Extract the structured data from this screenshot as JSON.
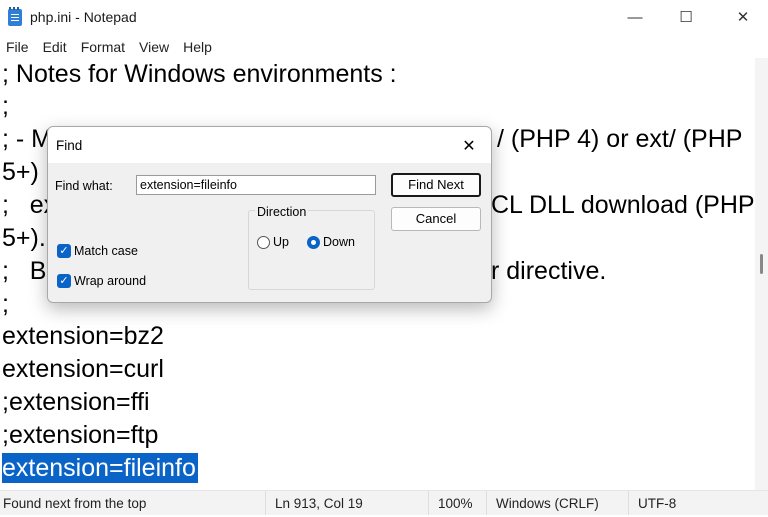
{
  "window": {
    "title": "php.ini - Notepad",
    "controls": {
      "minimize": "—",
      "maximize": "☐",
      "close": "✕"
    }
  },
  "menu": [
    {
      "label": "File"
    },
    {
      "label": "Edit"
    },
    {
      "label": "Format"
    },
    {
      "label": "View"
    },
    {
      "label": "Help"
    }
  ],
  "editor": {
    "lines": [
      "; Notes for Windows environments :",
      ";",
      "; - M",
      "5+)",
      ";   ex",
      "5+).",
      ";   Be",
      ";",
      "extension=bz2",
      "extension=curl",
      ";extension=ffi",
      ";extension=ftp",
      "extension=fileinfo"
    ],
    "right_fragments": [
      "/ (PHP 4) or ext/ (PHP",
      "CL DLL download (PHP",
      "r directive."
    ],
    "selected_line_index": 12
  },
  "find_dialog": {
    "title": "Find",
    "close_glyph": "✕",
    "find_what_label": "Find what:",
    "find_what_value": "extension=fileinfo",
    "find_next_label": "Find Next",
    "cancel_label": "Cancel",
    "direction_label": "Direction",
    "up_label": "Up",
    "down_label": "Down",
    "direction_selected": "down",
    "match_case_label": "Match case",
    "match_case_checked": true,
    "wrap_around_label": "Wrap around",
    "wrap_around_checked": true
  },
  "status": {
    "message": "Found next from the top",
    "position": "Ln 913, Col 19",
    "zoom": "100%",
    "line_ending": "Windows (CRLF)",
    "encoding": "UTF-8"
  },
  "colors": {
    "selection": "#0a64c8",
    "accent": "#0a64c8"
  }
}
